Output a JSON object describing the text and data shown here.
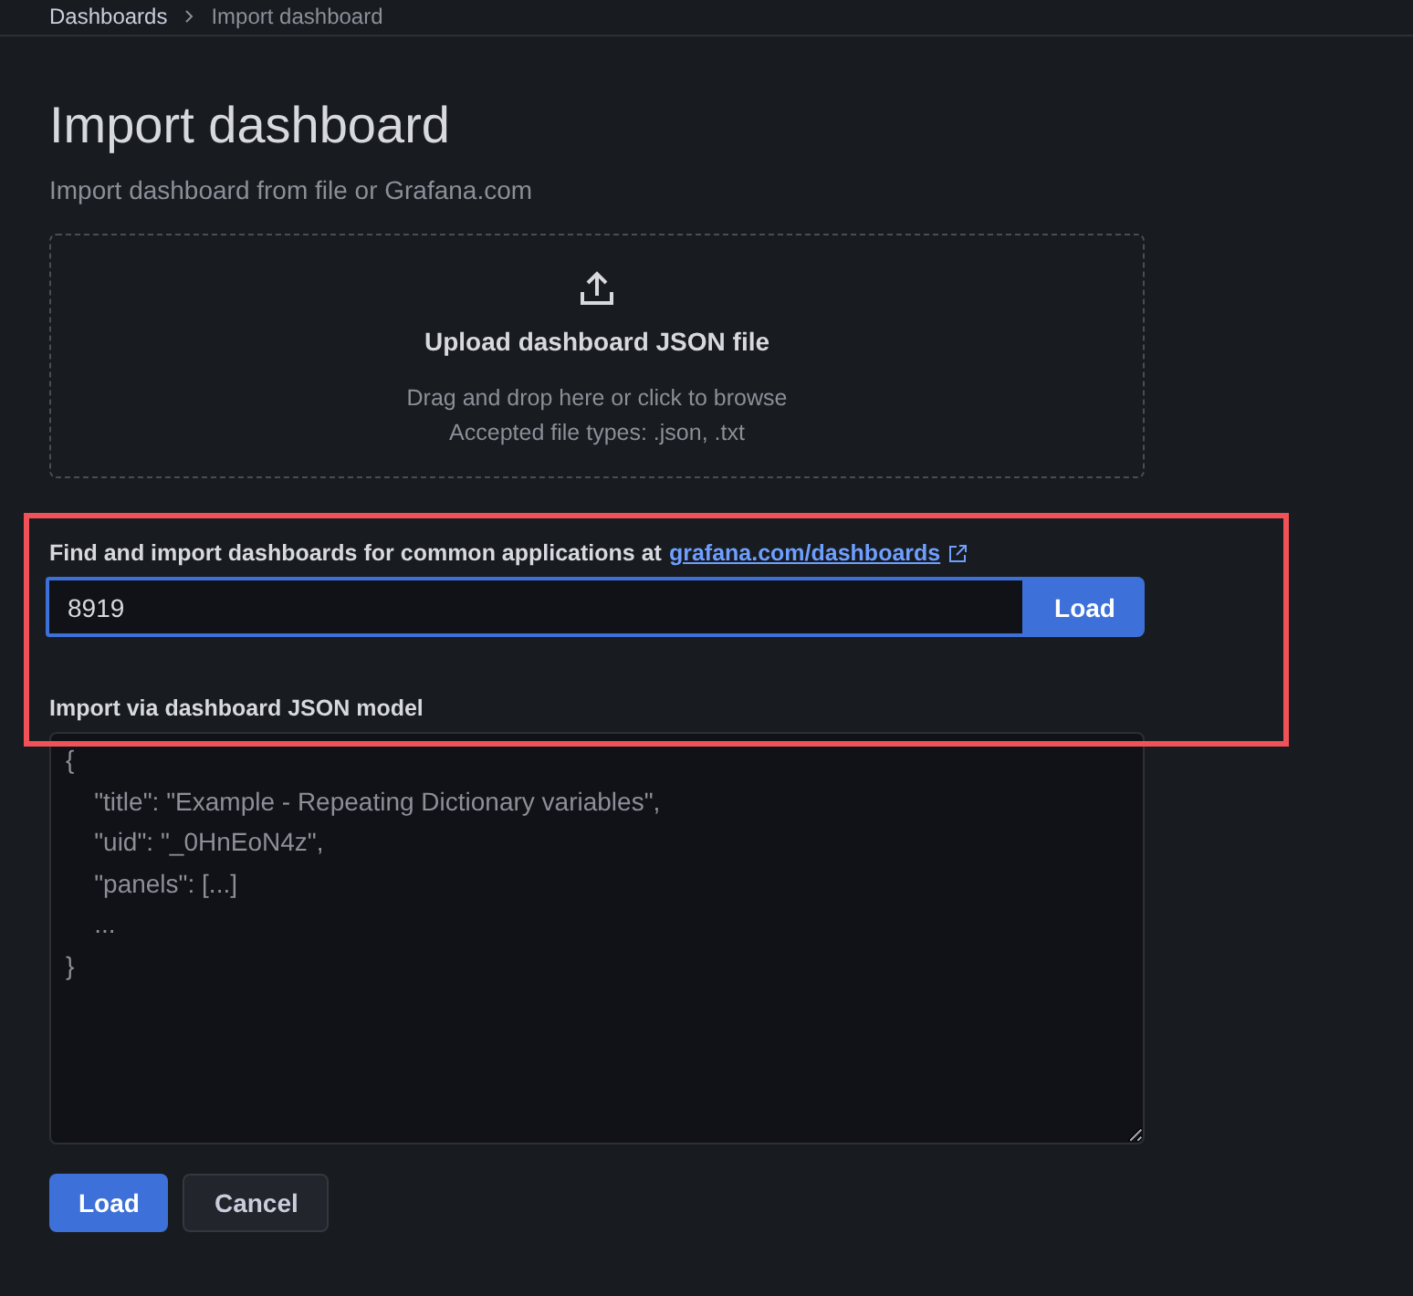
{
  "breadcrumb": [
    {
      "label": "Dashboards"
    },
    {
      "label": "Import dashboard"
    }
  ],
  "title": "Import dashboard",
  "subtitle": "Import dashboard from file or Grafana.com",
  "upload": {
    "title": "Upload dashboard JSON file",
    "hint": "Drag and drop here or click to browse",
    "accepted": "Accepted file types: .json, .txt"
  },
  "grafana_import": {
    "label": "Find and import dashboards for common applications at",
    "link": "grafana.com/dashboards",
    "value": "8919",
    "focused": true,
    "button": "Load"
  },
  "json_model": {
    "label": "Import via dashboard JSON model",
    "placeholder": "{\n    \"title\": \"Example - Repeating Dictionary variables\",\n    \"uid\": \"_0HnEoN4z\",\n    \"panels\": [...]\n    ...\n}"
  },
  "buttons": [
    {
      "label": "Load",
      "kind": "primary"
    },
    {
      "label": "Cancel",
      "kind": "secondary"
    }
  ]
}
